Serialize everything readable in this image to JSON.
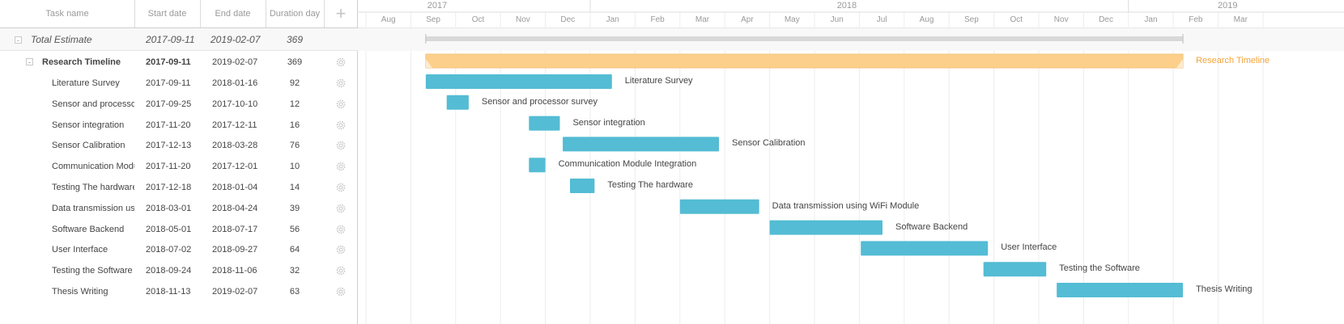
{
  "grid": {
    "headers": {
      "task_name": "Task name",
      "start_date": "Start date",
      "end_date": "End date",
      "duration": "Duration day",
      "add": "+"
    },
    "total": {
      "toggle": "-",
      "name": "Total Estimate",
      "start": "2017-09-11",
      "end": "2019-02-07",
      "duration": "369"
    },
    "parent": {
      "toggle": "-",
      "name": "Research Timeline",
      "start": "2017-09-11",
      "end": "2019-02-07",
      "duration": "369"
    },
    "tasks": [
      {
        "name": "Literature Survey",
        "start": "2017-09-11",
        "end": "2018-01-16",
        "duration": "92",
        "label": "Literature Survey"
      },
      {
        "name": "Sensor and processor",
        "start": "2017-09-25",
        "end": "2017-10-10",
        "duration": "12",
        "label": "Sensor and processor survey"
      },
      {
        "name": "Sensor integration",
        "start": "2017-11-20",
        "end": "2017-12-11",
        "duration": "16",
        "label": "Sensor integration"
      },
      {
        "name": "Sensor Calibration",
        "start": "2017-12-13",
        "end": "2018-03-28",
        "duration": "76",
        "label": "Sensor Calibration"
      },
      {
        "name": "Communication Modul",
        "start": "2017-11-20",
        "end": "2017-12-01",
        "duration": "10",
        "label": "Communication Module Integration"
      },
      {
        "name": "Testing The hardware",
        "start": "2017-12-18",
        "end": "2018-01-04",
        "duration": "14",
        "label": "Testing The hardware"
      },
      {
        "name": "Data transmission usir",
        "start": "2018-03-01",
        "end": "2018-04-24",
        "duration": "39",
        "label": "Data transmission using WiFi Module"
      },
      {
        "name": "Software Backend",
        "start": "2018-05-01",
        "end": "2018-07-17",
        "duration": "56",
        "label": "Software Backend"
      },
      {
        "name": "User Interface",
        "start": "2018-07-02",
        "end": "2018-09-27",
        "duration": "64",
        "label": "User Interface"
      },
      {
        "name": "Testing the Software",
        "start": "2018-09-24",
        "end": "2018-11-06",
        "duration": "32",
        "label": "Testing the Software"
      },
      {
        "name": "Thesis Writing",
        "start": "2018-11-13",
        "end": "2019-02-07",
        "duration": "63",
        "label": "Thesis Writing"
      }
    ]
  },
  "timeline": {
    "years": [
      "2017",
      "2018",
      "2019"
    ],
    "months": [
      "Aug",
      "Sep",
      "Oct",
      "Nov",
      "Dec",
      "Jan",
      "Feb",
      "Mar",
      "Apr",
      "May",
      "Jun",
      "Jul",
      "Aug",
      "Sep",
      "Oct",
      "Nov",
      "Dec",
      "Jan",
      "Feb",
      "Mar"
    ],
    "parent_label": "Research Timeline"
  },
  "colors": {
    "task_bar": "#54bcd4",
    "parent_bar": "#fcd08a",
    "parent_text": "#f4a43a",
    "total_bar": "#d8d8d8",
    "grid_line": "#ececec"
  }
}
